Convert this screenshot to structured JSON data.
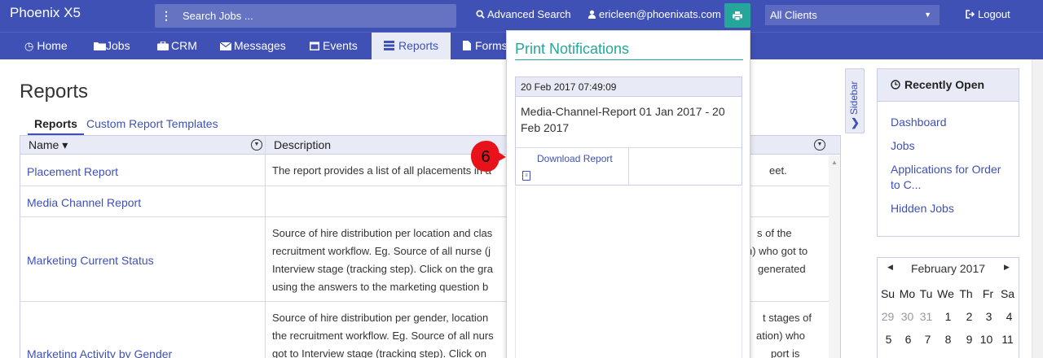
{
  "topbar": {
    "brand": "Phoenix X5",
    "search_placeholder": "Search Jobs ...",
    "advanced_search": "Advanced Search",
    "user": "ericleen@phoenixats.com",
    "clients": "All Clients",
    "logout": "Logout"
  },
  "nav": [
    {
      "label": "Home"
    },
    {
      "label": "Jobs"
    },
    {
      "label": "CRM"
    },
    {
      "label": "Messages"
    },
    {
      "label": "Events"
    },
    {
      "label": "Reports"
    },
    {
      "label": "Forms"
    }
  ],
  "page": {
    "title": "Reports",
    "tab_active": "Reports",
    "tab_link": "Custom Report Templates"
  },
  "table": {
    "col_name": "Name ▾",
    "col_desc": "Description",
    "rows": [
      {
        "name": "Placement Report",
        "desc": "The report provides a list of all placements in a",
        "desc_tail": "eet."
      },
      {
        "name": "Media Channel Report",
        "desc": ""
      },
      {
        "name": "Marketing Current Status",
        "desc": "Source of hire distribution per location and clas",
        "desc2": "recruitment workflow. Eg. Source of all nurse (j",
        "desc3": "Interview stage (tracking step). Click on the gra",
        "desc4": "using the answers to the marketing question b",
        "tail1": "s of the",
        "tail2": "n) who got to",
        "tail3": "generated"
      },
      {
        "name": "Marketing Activity by Gender",
        "desc": "Source of hire distribution per gender, location",
        "desc2": "the recruitment workflow. Eg. Source of all nurs",
        "desc3": "got to Interview stage (tracking step). Click on",
        "tail1": "t stages of",
        "tail2": "ation) who",
        "tail3": "port is"
      }
    ]
  },
  "popup": {
    "title": "Print Notifications",
    "timestamp": "20 Feb 2017 07:49:09",
    "report_name": "Media-Channel-Report 01 Jan 2017 - 20 Feb 2017",
    "download": "Download Report"
  },
  "marker": {
    "number": "6",
    "color": "#e8121b"
  },
  "sidebar": {
    "toggle_label": "Sidebar",
    "recent_title": "Recently Open",
    "recent_items": [
      "Dashboard",
      "Jobs",
      "Applications for Order to C...",
      "Hidden Jobs"
    ]
  },
  "calendar": {
    "month": "February 2017",
    "days_of_week": [
      "Su",
      "Mo",
      "Tu",
      "We",
      "Th",
      "Fr",
      "Sa"
    ],
    "week1": [
      "29",
      "30",
      "31",
      "1",
      "2",
      "3",
      "4"
    ],
    "week2": [
      "5",
      "6",
      "7",
      "8",
      "9",
      "10",
      "11"
    ]
  },
  "colors": {
    "primary": "#3f51b5",
    "accent": "#26a69a",
    "light": "#e8eaf6"
  }
}
